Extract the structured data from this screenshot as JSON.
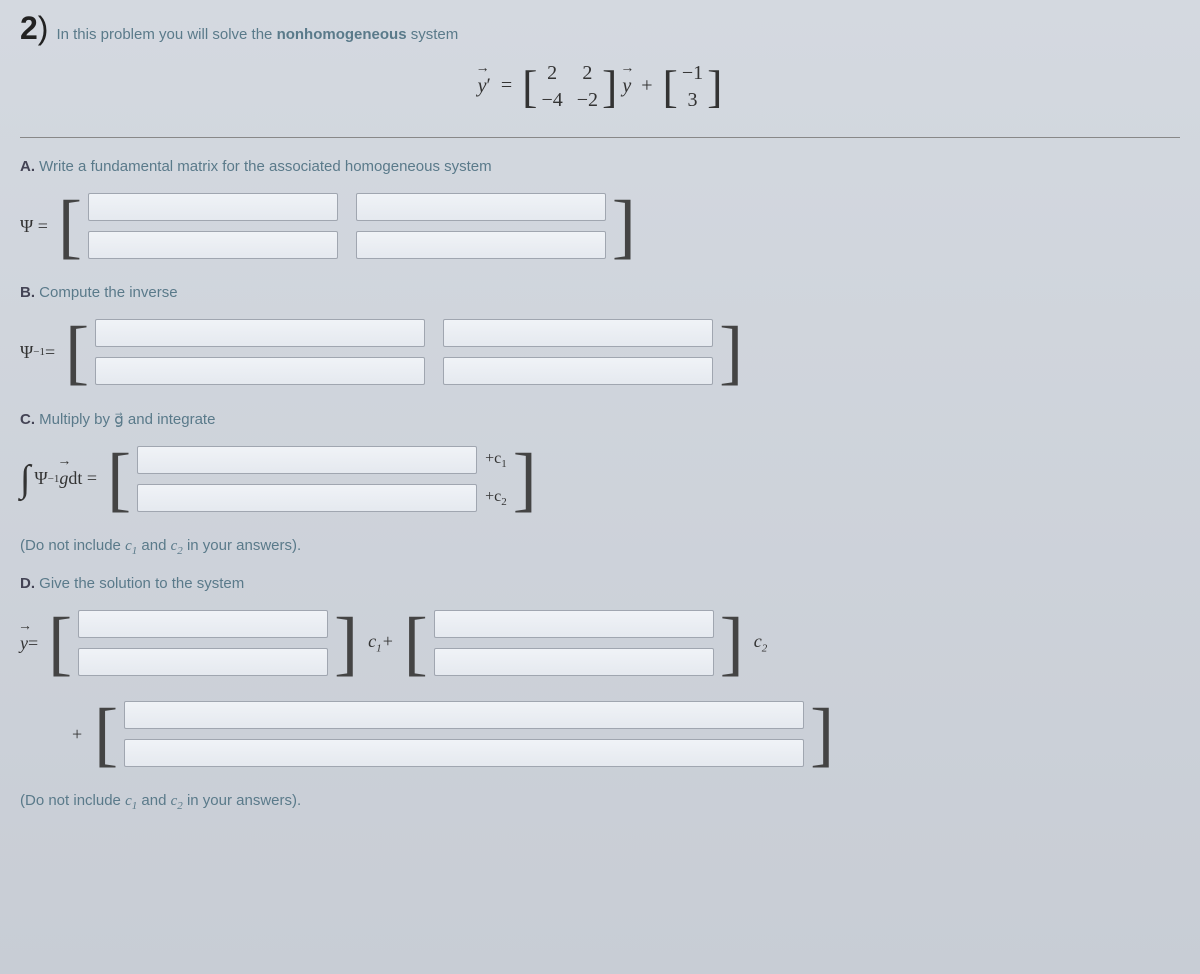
{
  "problem": {
    "number": "2",
    "paren": ")",
    "intro_prefix": "In this problem you will solve the ",
    "intro_bold": "nonhomogeneous",
    "intro_suffix": " system"
  },
  "equation": {
    "lhs_var": "y",
    "lhs_prime": "′",
    "eq": "=",
    "A": {
      "r1c1": "2",
      "r1c2": "2",
      "r2c1": "−4",
      "r2c2": "−2"
    },
    "mid_var": "y",
    "plus": "+",
    "g": {
      "r1": "−1",
      "r2": "3"
    }
  },
  "partA": {
    "label_letter": "A.",
    "label_text": " Write a fundamental matrix for the associated homogeneous system",
    "lhs": "Ψ  ="
  },
  "partB": {
    "label_letter": "B.",
    "label_text": " Compute the inverse",
    "lhs_base": "Ψ",
    "lhs_sup": "−1",
    "lhs_eq": " ="
  },
  "partC": {
    "label_letter": "C.",
    "label_text": " Multiply by g⃗ and integrate",
    "lhs_int": "∫",
    "lhs_psi": "Ψ",
    "lhs_sup": "−1",
    "lhs_g": "g",
    "lhs_dt": " dt  =",
    "c1": "+c",
    "c1_sub": "1",
    "c2": "+c",
    "c2_sub": "2",
    "note_prefix": "(Do not include ",
    "note_c1": "c",
    "note_c1_sub": "1",
    "note_and": " and ",
    "note_c2": "c",
    "note_c2_sub": "2",
    "note_suffix": " in your answers)."
  },
  "partD": {
    "label_letter": "D.",
    "label_text": " Give the solution to the system",
    "lhs_var": "y",
    "lhs_eq": "  =",
    "c1_base": "c",
    "c1_sub": "1",
    "c1_plus": "+",
    "c2_base": "c",
    "c2_sub": "2",
    "plus": "+",
    "note_prefix": "(Do not include ",
    "note_c1": "c",
    "note_c1_sub": "1",
    "note_and": " and ",
    "note_c2": "c",
    "note_c2_sub": "2",
    "note_suffix": " in your answers)."
  }
}
